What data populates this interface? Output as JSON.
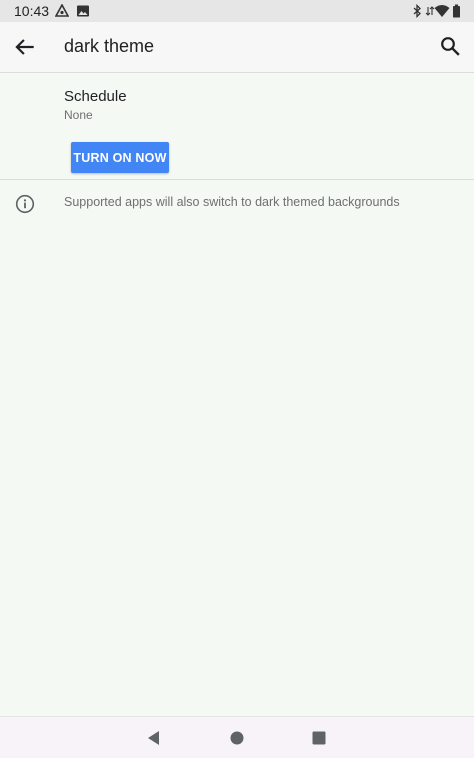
{
  "status_bar": {
    "time": "10:43",
    "icons": [
      "assistant-icon",
      "image-icon",
      "bluetooth-icon",
      "signal-arrows-icon",
      "wifi-icon",
      "battery-icon"
    ]
  },
  "app_bar": {
    "title": "dark theme",
    "back_icon": "arrow-back-icon",
    "search_icon": "search-icon"
  },
  "schedule": {
    "title": "Schedule",
    "value": "None"
  },
  "action": {
    "turn_on_label": "TURN ON NOW"
  },
  "info": {
    "icon": "info-icon",
    "text": "Supported apps will also switch to dark themed backgrounds"
  },
  "nav_bar": {
    "buttons": [
      "back-triangle-icon",
      "home-circle-icon",
      "recents-square-icon"
    ]
  },
  "colors": {
    "accent": "#4285f4",
    "background": "#f4f9f4",
    "status_bar": "#e6e6e6"
  }
}
